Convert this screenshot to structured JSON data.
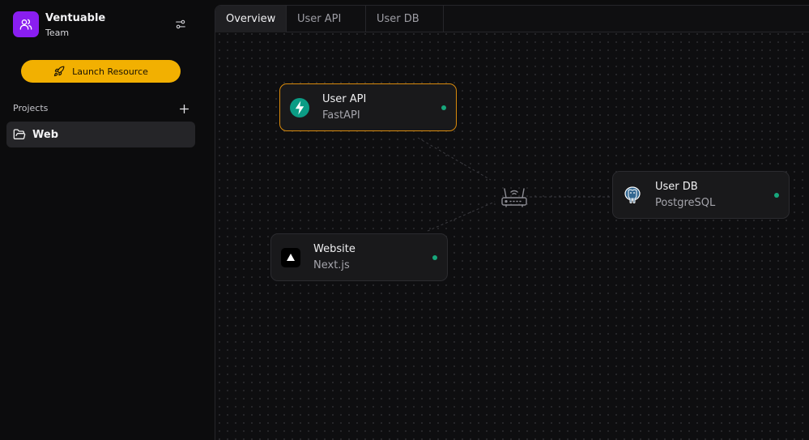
{
  "team": {
    "name": "Ventuable",
    "subtitle": "Team"
  },
  "sidebar": {
    "launch_label": "Launch Resource",
    "projects_label": "Projects",
    "projects": [
      {
        "label": "Web",
        "icon": "folder-open-icon"
      }
    ]
  },
  "tabs": [
    {
      "label": "Overview",
      "active": true
    },
    {
      "label": "User API",
      "active": false
    },
    {
      "label": "User DB",
      "active": false
    }
  ],
  "nodes": [
    {
      "title": "User API",
      "subtitle": "FastAPI",
      "icon": "fastapi-icon",
      "status": "running",
      "selected": true
    },
    {
      "title": "Website",
      "subtitle": "Next.js",
      "icon": "nextjs-icon",
      "status": "running",
      "selected": false
    },
    {
      "title": "User DB",
      "subtitle": "PostgreSQL",
      "icon": "postgresql-icon",
      "status": "running",
      "selected": false
    }
  ],
  "colors": {
    "accent": "#f2b001",
    "brand": "#8a1ef0",
    "status_running": "#17a77c",
    "selected_border": "#d98a0c"
  }
}
